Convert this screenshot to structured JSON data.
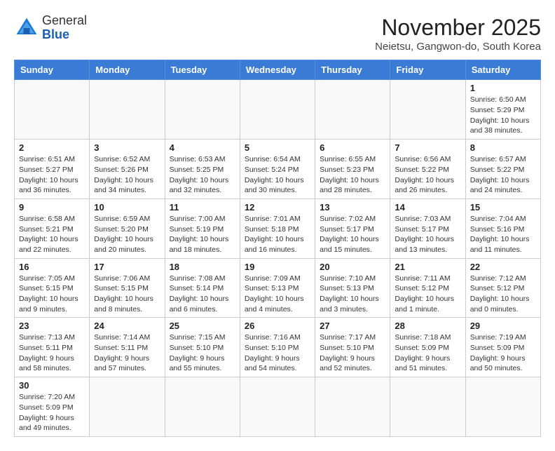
{
  "header": {
    "logo_general": "General",
    "logo_blue": "Blue",
    "month_title": "November 2025",
    "location": "Neietsu, Gangwon-do, South Korea"
  },
  "weekdays": [
    "Sunday",
    "Monday",
    "Tuesday",
    "Wednesday",
    "Thursday",
    "Friday",
    "Saturday"
  ],
  "weeks": [
    [
      {
        "day": "",
        "info": ""
      },
      {
        "day": "",
        "info": ""
      },
      {
        "day": "",
        "info": ""
      },
      {
        "day": "",
        "info": ""
      },
      {
        "day": "",
        "info": ""
      },
      {
        "day": "",
        "info": ""
      },
      {
        "day": "1",
        "info": "Sunrise: 6:50 AM\nSunset: 5:29 PM\nDaylight: 10 hours\nand 38 minutes."
      }
    ],
    [
      {
        "day": "2",
        "info": "Sunrise: 6:51 AM\nSunset: 5:27 PM\nDaylight: 10 hours\nand 36 minutes."
      },
      {
        "day": "3",
        "info": "Sunrise: 6:52 AM\nSunset: 5:26 PM\nDaylight: 10 hours\nand 34 minutes."
      },
      {
        "day": "4",
        "info": "Sunrise: 6:53 AM\nSunset: 5:25 PM\nDaylight: 10 hours\nand 32 minutes."
      },
      {
        "day": "5",
        "info": "Sunrise: 6:54 AM\nSunset: 5:24 PM\nDaylight: 10 hours\nand 30 minutes."
      },
      {
        "day": "6",
        "info": "Sunrise: 6:55 AM\nSunset: 5:23 PM\nDaylight: 10 hours\nand 28 minutes."
      },
      {
        "day": "7",
        "info": "Sunrise: 6:56 AM\nSunset: 5:22 PM\nDaylight: 10 hours\nand 26 minutes."
      },
      {
        "day": "8",
        "info": "Sunrise: 6:57 AM\nSunset: 5:22 PM\nDaylight: 10 hours\nand 24 minutes."
      }
    ],
    [
      {
        "day": "9",
        "info": "Sunrise: 6:58 AM\nSunset: 5:21 PM\nDaylight: 10 hours\nand 22 minutes."
      },
      {
        "day": "10",
        "info": "Sunrise: 6:59 AM\nSunset: 5:20 PM\nDaylight: 10 hours\nand 20 minutes."
      },
      {
        "day": "11",
        "info": "Sunrise: 7:00 AM\nSunset: 5:19 PM\nDaylight: 10 hours\nand 18 minutes."
      },
      {
        "day": "12",
        "info": "Sunrise: 7:01 AM\nSunset: 5:18 PM\nDaylight: 10 hours\nand 16 minutes."
      },
      {
        "day": "13",
        "info": "Sunrise: 7:02 AM\nSunset: 5:17 PM\nDaylight: 10 hours\nand 15 minutes."
      },
      {
        "day": "14",
        "info": "Sunrise: 7:03 AM\nSunset: 5:17 PM\nDaylight: 10 hours\nand 13 minutes."
      },
      {
        "day": "15",
        "info": "Sunrise: 7:04 AM\nSunset: 5:16 PM\nDaylight: 10 hours\nand 11 minutes."
      }
    ],
    [
      {
        "day": "16",
        "info": "Sunrise: 7:05 AM\nSunset: 5:15 PM\nDaylight: 10 hours\nand 9 minutes."
      },
      {
        "day": "17",
        "info": "Sunrise: 7:06 AM\nSunset: 5:15 PM\nDaylight: 10 hours\nand 8 minutes."
      },
      {
        "day": "18",
        "info": "Sunrise: 7:08 AM\nSunset: 5:14 PM\nDaylight: 10 hours\nand 6 minutes."
      },
      {
        "day": "19",
        "info": "Sunrise: 7:09 AM\nSunset: 5:13 PM\nDaylight: 10 hours\nand 4 minutes."
      },
      {
        "day": "20",
        "info": "Sunrise: 7:10 AM\nSunset: 5:13 PM\nDaylight: 10 hours\nand 3 minutes."
      },
      {
        "day": "21",
        "info": "Sunrise: 7:11 AM\nSunset: 5:12 PM\nDaylight: 10 hours\nand 1 minute."
      },
      {
        "day": "22",
        "info": "Sunrise: 7:12 AM\nSunset: 5:12 PM\nDaylight: 10 hours\nand 0 minutes."
      }
    ],
    [
      {
        "day": "23",
        "info": "Sunrise: 7:13 AM\nSunset: 5:11 PM\nDaylight: 9 hours\nand 58 minutes."
      },
      {
        "day": "24",
        "info": "Sunrise: 7:14 AM\nSunset: 5:11 PM\nDaylight: 9 hours\nand 57 minutes."
      },
      {
        "day": "25",
        "info": "Sunrise: 7:15 AM\nSunset: 5:10 PM\nDaylight: 9 hours\nand 55 minutes."
      },
      {
        "day": "26",
        "info": "Sunrise: 7:16 AM\nSunset: 5:10 PM\nDaylight: 9 hours\nand 54 minutes."
      },
      {
        "day": "27",
        "info": "Sunrise: 7:17 AM\nSunset: 5:10 PM\nDaylight: 9 hours\nand 52 minutes."
      },
      {
        "day": "28",
        "info": "Sunrise: 7:18 AM\nSunset: 5:09 PM\nDaylight: 9 hours\nand 51 minutes."
      },
      {
        "day": "29",
        "info": "Sunrise: 7:19 AM\nSunset: 5:09 PM\nDaylight: 9 hours\nand 50 minutes."
      }
    ],
    [
      {
        "day": "30",
        "info": "Sunrise: 7:20 AM\nSunset: 5:09 PM\nDaylight: 9 hours\nand 49 minutes."
      },
      {
        "day": "",
        "info": ""
      },
      {
        "day": "",
        "info": ""
      },
      {
        "day": "",
        "info": ""
      },
      {
        "day": "",
        "info": ""
      },
      {
        "day": "",
        "info": ""
      },
      {
        "day": "",
        "info": ""
      }
    ]
  ]
}
